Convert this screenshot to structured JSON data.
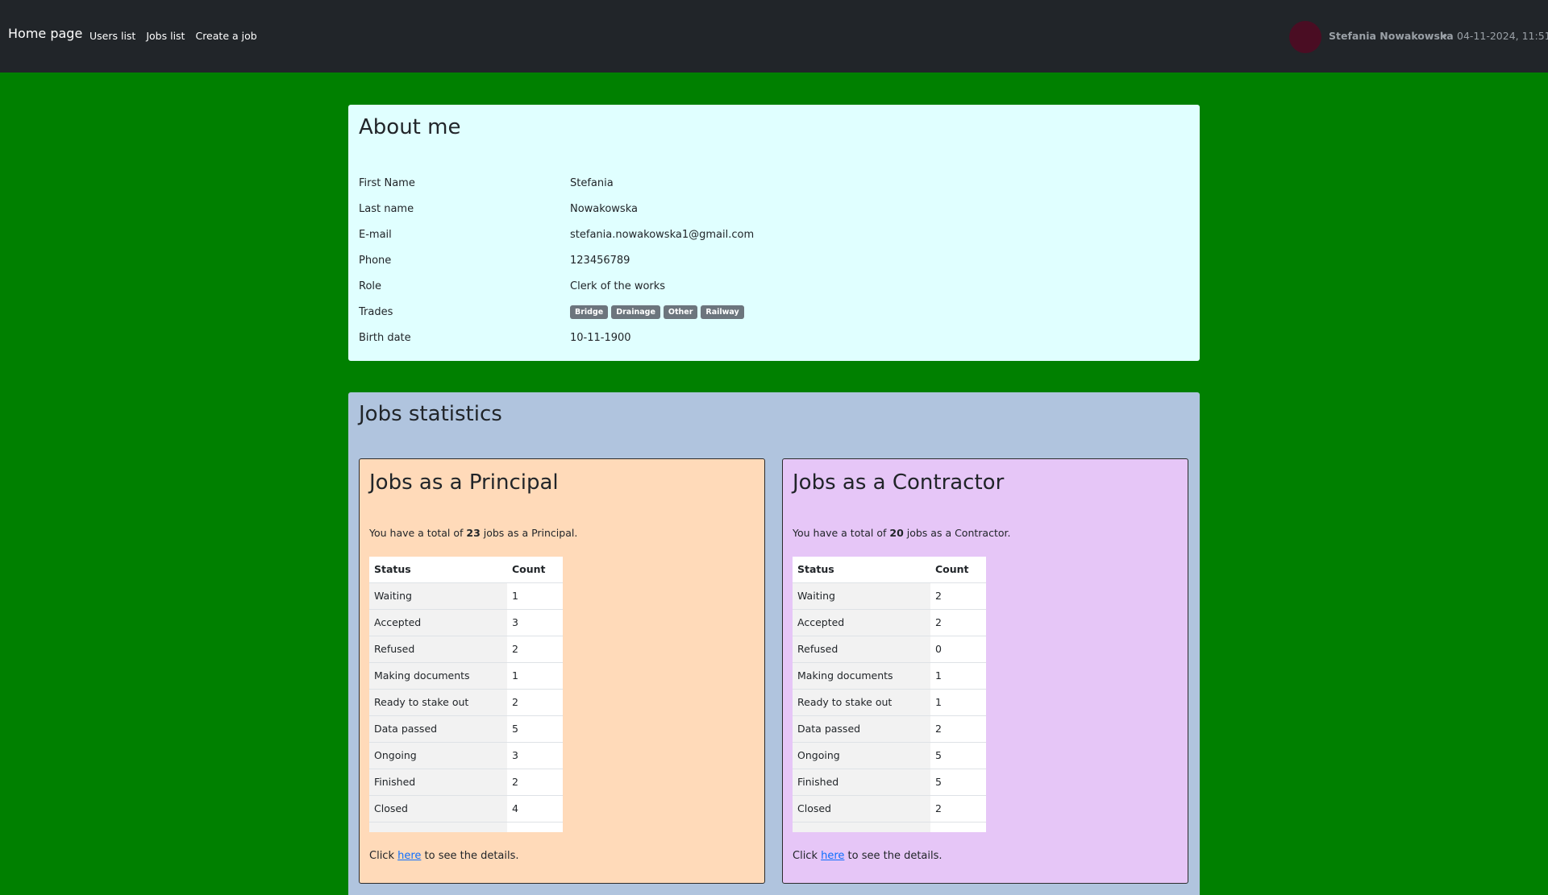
{
  "navbar": {
    "brand": "Home page",
    "links": [
      "Users list",
      "Jobs list",
      "Create a job"
    ],
    "user_name": "Stefania Nowakowska",
    "datetime": "04-11-2024, 11:51"
  },
  "about": {
    "title": "About me",
    "rows": [
      {
        "label": "First Name",
        "value": "Stefania"
      },
      {
        "label": "Last name",
        "value": "Nowakowska"
      },
      {
        "label": "E-mail",
        "value": "stefania.nowakowska1@gmail.com"
      },
      {
        "label": "Phone",
        "value": "123456789"
      },
      {
        "label": "Role",
        "value": "Clerk of the works"
      },
      {
        "label": "Trades",
        "badges": [
          "Bridge",
          "Drainage",
          "Other",
          "Railway"
        ]
      },
      {
        "label": "Birth date",
        "value": "10-11-1900"
      }
    ]
  },
  "stats": {
    "title": "Jobs statistics",
    "principal": {
      "title": "Jobs as a Principal",
      "total_prefix": "You have a total of ",
      "total": "23",
      "total_suffix": " jobs as a Principal.",
      "headers": [
        "Status",
        "Count"
      ],
      "rows": [
        [
          "Waiting",
          "1"
        ],
        [
          "Accepted",
          "3"
        ],
        [
          "Refused",
          "2"
        ],
        [
          "Making documents",
          "1"
        ],
        [
          "Ready to stake out",
          "2"
        ],
        [
          "Data passed",
          "5"
        ],
        [
          "Ongoing",
          "3"
        ],
        [
          "Finished",
          "2"
        ],
        [
          "Closed",
          "4"
        ]
      ],
      "details_prefix": "Click ",
      "details_link": "here",
      "details_suffix": " to see the details."
    },
    "contractor": {
      "title": "Jobs as a Contractor",
      "total_prefix": "You have a total of ",
      "total": "20",
      "total_suffix": " jobs as a Contractor.",
      "headers": [
        "Status",
        "Count"
      ],
      "rows": [
        [
          "Waiting",
          "2"
        ],
        [
          "Accepted",
          "2"
        ],
        [
          "Refused",
          "0"
        ],
        [
          "Making documents",
          "1"
        ],
        [
          "Ready to stake out",
          "1"
        ],
        [
          "Data passed",
          "2"
        ],
        [
          "Ongoing",
          "5"
        ],
        [
          "Finished",
          "5"
        ],
        [
          "Closed",
          "2"
        ]
      ],
      "details_prefix": "Click ",
      "details_link": "here",
      "details_suffix": " to see the details."
    }
  },
  "colors": {
    "page_background": "#008000",
    "navbar": "#212529",
    "about_card": "#e0ffff",
    "stats_card": "#b0c4de",
    "principal_card": "#ffdab9",
    "contractor_card": "#e6c6f7",
    "avatar": "#4a0d23"
  }
}
